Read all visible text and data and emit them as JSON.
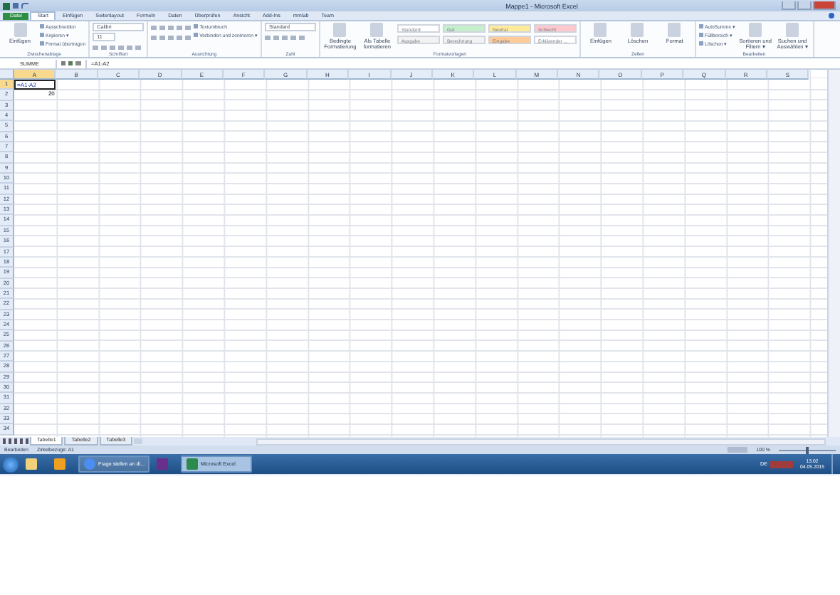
{
  "window": {
    "title": "Mappe1 - Microsoft Excel"
  },
  "tabs": [
    {
      "label": "Datei",
      "kind": "file",
      "selected": false
    },
    {
      "label": "Start",
      "kind": "tab",
      "selected": true
    },
    {
      "label": "Einfügen",
      "kind": "tab",
      "selected": false
    },
    {
      "label": "Seitenlayout",
      "kind": "tab",
      "selected": false
    },
    {
      "label": "Formeln",
      "kind": "tab",
      "selected": false
    },
    {
      "label": "Daten",
      "kind": "tab",
      "selected": false
    },
    {
      "label": "Überprüfen",
      "kind": "tab",
      "selected": false
    },
    {
      "label": "Ansicht",
      "kind": "tab",
      "selected": false
    },
    {
      "label": "Add-Ins",
      "kind": "tab",
      "selected": false
    },
    {
      "label": "mmlab",
      "kind": "tab",
      "selected": false
    },
    {
      "label": "Team",
      "kind": "tab",
      "selected": false
    }
  ],
  "ribbon": [
    {
      "label": "Zwischenablage",
      "items": [
        {
          "kind": "large",
          "label": "Einfügen"
        },
        {
          "kind": "small",
          "label": "Ausschneiden"
        },
        {
          "kind": "small",
          "label": "Kopieren ▾"
        },
        {
          "kind": "small",
          "label": "Format übertragen"
        }
      ]
    },
    {
      "label": "Schriftart",
      "items": [
        {
          "kind": "field",
          "value": "Calibri",
          "wide": true
        },
        {
          "kind": "field",
          "value": "11",
          "wide": false
        },
        {
          "kind": "fontbuttons"
        }
      ]
    },
    {
      "label": "Ausrichtung",
      "items": [
        {
          "kind": "alignbuttons"
        },
        {
          "kind": "small",
          "label": "Textumbruch"
        },
        {
          "kind": "small",
          "label": "Verbinden und zentrieren ▾"
        }
      ]
    },
    {
      "label": "Zahl",
      "items": [
        {
          "kind": "field",
          "value": "Standard",
          "wide": true
        },
        {
          "kind": "numberbuttons"
        }
      ]
    },
    {
      "label": "Formatvorlagen",
      "items": [
        {
          "kind": "large",
          "label": "Bedingte Formatierung"
        },
        {
          "kind": "large",
          "label": "Als Tabelle formatieren"
        },
        {
          "kind": "style",
          "label": "Standard",
          "color": "#ffffff"
        },
        {
          "kind": "style",
          "label": "Ausgabe",
          "color": "#f2f2f2"
        },
        {
          "kind": "style",
          "label": "Gut",
          "color": "#c6efce"
        },
        {
          "kind": "style",
          "label": "Berechnung",
          "color": "#f2f2f2"
        },
        {
          "kind": "style",
          "label": "Neutral",
          "color": "#ffeb9c"
        },
        {
          "kind": "style",
          "label": "Eingabe",
          "color": "#ffcc99"
        },
        {
          "kind": "style",
          "label": "Schlecht",
          "color": "#ffc7ce"
        },
        {
          "kind": "style",
          "label": "Erklärender ...",
          "color": "#ffffff"
        }
      ]
    },
    {
      "label": "Zellen",
      "items": [
        {
          "kind": "large",
          "label": "Einfügen"
        },
        {
          "kind": "large",
          "label": "Löschen"
        },
        {
          "kind": "large",
          "label": "Format"
        }
      ]
    },
    {
      "label": "Bearbeiten",
      "items": [
        {
          "kind": "small",
          "label": "AutoSumme ▾"
        },
        {
          "kind": "small",
          "label": "Füllbereich ▾"
        },
        {
          "kind": "small",
          "label": "Löschen ▾"
        },
        {
          "kind": "large",
          "label": "Sortieren und Filtern ▾"
        },
        {
          "kind": "large",
          "label": "Suchen und Auswählen ▾"
        }
      ]
    }
  ],
  "formula_bar": {
    "name_box": "SUMME",
    "formula": "=A1-A2"
  },
  "columns": [
    {
      "label": "A",
      "selected": true
    },
    {
      "label": "B",
      "selected": false
    },
    {
      "label": "C",
      "selected": false
    },
    {
      "label": "D",
      "selected": false
    },
    {
      "label": "E",
      "selected": false
    },
    {
      "label": "F",
      "selected": false
    },
    {
      "label": "G",
      "selected": false
    },
    {
      "label": "H",
      "selected": false
    },
    {
      "label": "I",
      "selected": false
    },
    {
      "label": "J",
      "selected": false
    },
    {
      "label": "K",
      "selected": false
    },
    {
      "label": "L",
      "selected": false
    },
    {
      "label": "M",
      "selected": false
    },
    {
      "label": "N",
      "selected": false
    },
    {
      "label": "O",
      "selected": false
    },
    {
      "label": "P",
      "selected": false
    },
    {
      "label": "Q",
      "selected": false
    },
    {
      "label": "R",
      "selected": false
    },
    {
      "label": "S",
      "selected": false
    }
  ],
  "rows": [
    {
      "header": "1",
      "selected": true,
      "cells": [
        {
          "value": "=A1-A2",
          "kind": "formula",
          "editing": true
        }
      ]
    },
    {
      "header": "2",
      "selected": false,
      "cells": [
        {
          "value": "20",
          "kind": "number",
          "editing": false
        }
      ]
    },
    {
      "header": "3",
      "selected": false
    },
    {
      "header": "4",
      "selected": false
    },
    {
      "header": "5",
      "selected": false
    },
    {
      "header": "6",
      "selected": false
    },
    {
      "header": "7",
      "selected": false
    },
    {
      "header": "8",
      "selected": false
    },
    {
      "header": "9",
      "selected": false
    },
    {
      "header": "10",
      "selected": false
    },
    {
      "header": "11",
      "selected": false
    },
    {
      "header": "12",
      "selected": false
    },
    {
      "header": "13",
      "selected": false
    },
    {
      "header": "14",
      "selected": false
    },
    {
      "header": "15",
      "selected": false
    },
    {
      "header": "16",
      "selected": false
    },
    {
      "header": "17",
      "selected": false
    },
    {
      "header": "18",
      "selected": false
    },
    {
      "header": "19",
      "selected": false
    },
    {
      "header": "20",
      "selected": false
    },
    {
      "header": "21",
      "selected": false
    },
    {
      "header": "22",
      "selected": false
    },
    {
      "header": "23",
      "selected": false
    },
    {
      "header": "24",
      "selected": false
    },
    {
      "header": "25",
      "selected": false
    },
    {
      "header": "26",
      "selected": false
    },
    {
      "header": "27",
      "selected": false
    },
    {
      "header": "28",
      "selected": false
    },
    {
      "header": "29",
      "selected": false
    },
    {
      "header": "30",
      "selected": false
    },
    {
      "header": "31",
      "selected": false
    },
    {
      "header": "32",
      "selected": false
    },
    {
      "header": "33",
      "selected": false
    },
    {
      "header": "34",
      "selected": false
    }
  ],
  "sheets": [
    {
      "label": "Tabelle1",
      "selected": true
    },
    {
      "label": "Tabelle2",
      "selected": false
    },
    {
      "label": "Tabelle3",
      "selected": false
    }
  ],
  "status_bar": {
    "texts": [
      "Bearbeiten",
      "Zirkelbezüge: A1"
    ],
    "zoom": "100 %",
    "zoom_slider": {
      "level": 0.5
    }
  },
  "taskbar": {
    "items": [
      {
        "kind": "folder",
        "active": false
      },
      {
        "kind": "mail",
        "active": false
      },
      {
        "kind": "browser",
        "label": "Frage stellen an di...",
        "active": false
      },
      {
        "kind": "purple",
        "active": false
      },
      {
        "kind": "excel",
        "label": "Microsoft Excel",
        "active": true
      }
    ],
    "language": "DE",
    "time": "13:02",
    "date": "04.05.2015"
  }
}
